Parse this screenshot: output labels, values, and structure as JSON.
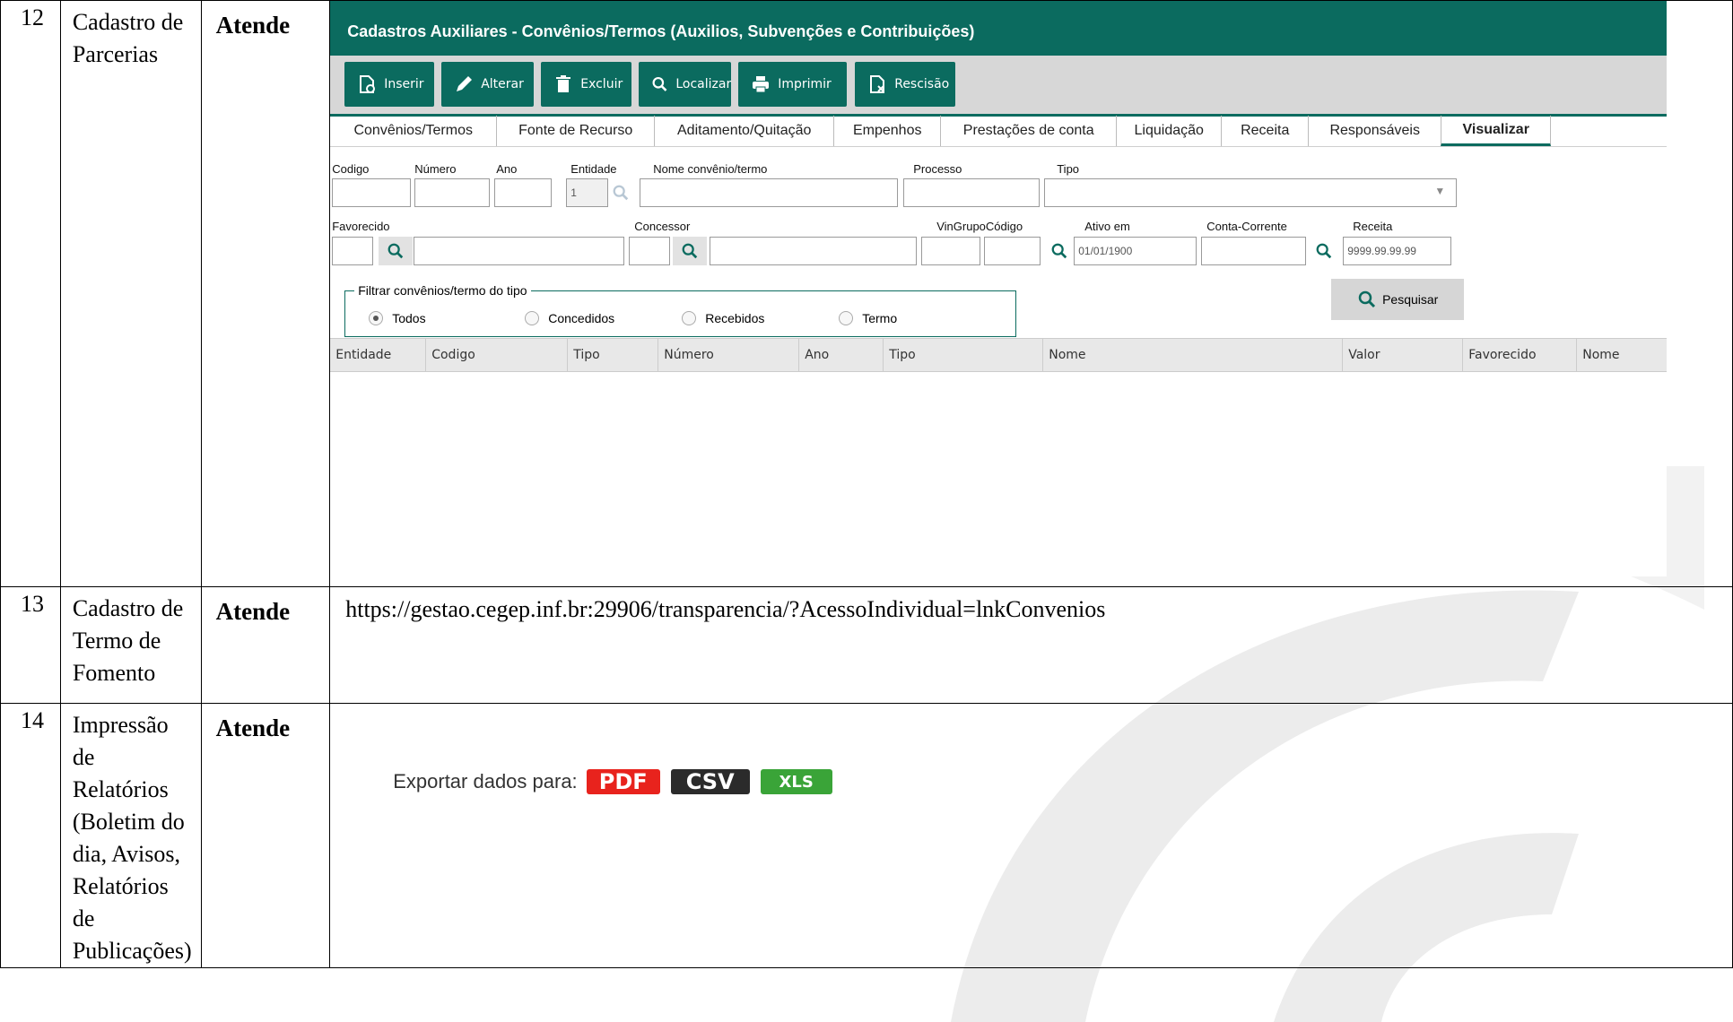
{
  "rows": [
    {
      "num": "12",
      "name": "Cadastro de Parcerias",
      "status": "Atende"
    },
    {
      "num": "13",
      "name": "Cadastro de Termo de Fomento",
      "status": "Atende",
      "content": "https://gestao.cegep.inf.br:29906/transparencia/?AcessoIndividual=lnkConvenios"
    },
    {
      "num": "14",
      "name": "Impressão de Relatórios (Boletim do dia, Avisos, Relatórios de Publicações)",
      "status": "Atende"
    }
  ],
  "app": {
    "title": "Cadastros Auxiliares - Convênios/Termos (Auxilios, Subvenções e Contribuições)",
    "toolbar": {
      "inserir": "Inserir",
      "alterar": "Alterar",
      "excluir": "Excluir",
      "localizar": "Localizar",
      "imprimir": "Imprimir",
      "rescisao": "Rescisão"
    },
    "tabs": [
      "Convênios/Termos",
      "Fonte de Recurso",
      "Aditamento/Quitação",
      "Empenhos",
      "Prestações de conta",
      "Liquidação",
      "Receita",
      "Responsáveis",
      "Visualizar"
    ],
    "active_tab": "Visualizar",
    "labels": {
      "codigo": "Codigo",
      "numero": "Número",
      "ano": "Ano",
      "entidade": "Entidade",
      "nome": "Nome convênio/termo",
      "processo": "Processo",
      "tipo": "Tipo",
      "favorecido": "Favorecido",
      "concessor": "Concessor",
      "vingrupo": "VinGrupoCódigo",
      "ativo": "Ativo em",
      "conta": "Conta-Corrente",
      "receita": "Receita"
    },
    "values": {
      "entidade": "1",
      "ativo": "01/01/1900",
      "receita": "9999.99.99.99"
    },
    "filter": {
      "legend": "Filtrar convênios/termo do tipo",
      "options": [
        "Todos",
        "Concedidos",
        "Recebidos",
        "Termo"
      ],
      "selected": "Todos"
    },
    "search_button": "Pesquisar",
    "columns": [
      "Entidade",
      "Codigo",
      "Tipo",
      "Número",
      "Ano",
      "Tipo",
      "Nome",
      "Valor",
      "Favorecido",
      "Nome"
    ]
  },
  "export": {
    "label": "Exportar dados para:",
    "pdf": "PDF",
    "csv": "CSV",
    "xls": "XLS",
    "colors": {
      "pdf": "#e8231d",
      "csv": "#2b2b2b",
      "xls": "#3aa438"
    }
  },
  "colors": {
    "accent": "#0b6b5f"
  }
}
